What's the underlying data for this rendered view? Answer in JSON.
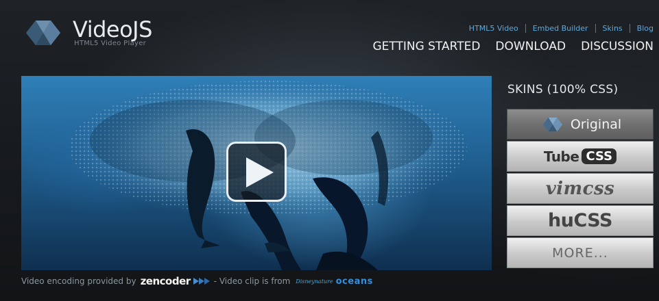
{
  "header": {
    "logo_title": "VideoJS",
    "logo_subtitle": "HTML5 Video Player",
    "top_links": [
      "HTML5 Video",
      "Embed Builder",
      "Skins",
      "Blog"
    ],
    "main_nav": [
      "GETTING STARTED",
      "DOWNLOAD",
      "DISCUSSION"
    ]
  },
  "video": {
    "play_icon": "play-icon"
  },
  "caption": {
    "prefix": "Video encoding provided by",
    "zencoder": "zencoder",
    "middle": "- Video clip is from",
    "disneynature": "Disneynature",
    "oceans": "oceans"
  },
  "skins": {
    "title": "SKINS (100% CSS)",
    "items": {
      "original": "Original",
      "tube": "Tube",
      "tube_css": "CSS",
      "vimcss": "vimcss",
      "hucss": "huCSS",
      "more": "MORE..."
    }
  },
  "colors": {
    "link": "#5fa8dc",
    "background": "#15181b",
    "logo_blue": "#4f7fa6"
  }
}
